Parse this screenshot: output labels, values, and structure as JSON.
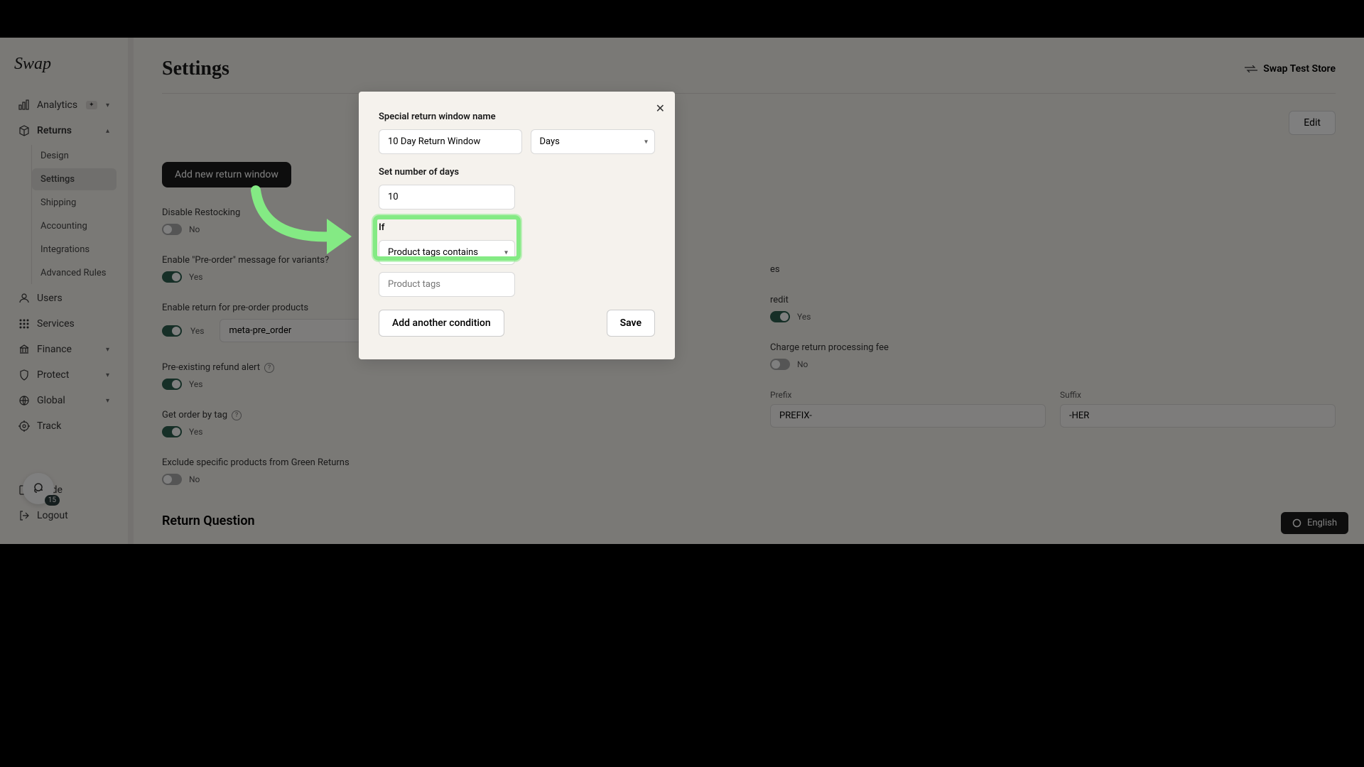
{
  "logo": "Swap",
  "sidebar": {
    "analytics": "Analytics",
    "returns": "Returns",
    "sub": {
      "design": "Design",
      "settings": "Settings",
      "shipping": "Shipping",
      "accounting": "Accounting",
      "integrations": "Integrations",
      "advanced": "Advanced Rules"
    },
    "users": "Users",
    "services": "Services",
    "finance": "Finance",
    "protect": "Protect",
    "global": "Global",
    "track": "Track",
    "guide": "Guide",
    "logout": "Logout"
  },
  "chat_badge": "15",
  "header": {
    "title": "Settings",
    "store": "Swap Test Store",
    "edit": "Edit"
  },
  "buttons": {
    "add_return_window": "Add new return window"
  },
  "settings": {
    "disable_restocking": {
      "label": "Disable Restocking",
      "value": "No"
    },
    "preorder_msg": {
      "label": "Enable \"Pre-order\" message for variants?",
      "value": "Yes"
    },
    "preorder_return": {
      "label": "Enable return for pre-order products",
      "value": "Yes",
      "input": "meta-pre_order"
    },
    "refund_alert": {
      "label": "Pre-existing refund alert",
      "value": "Yes"
    },
    "order_by_tag": {
      "label": "Get order by tag",
      "value": "Yes"
    },
    "exclude_green": {
      "label": "Exclude specific products from Green Returns",
      "value": "No"
    },
    "right1": {
      "label": "es",
      "value": ""
    },
    "store_credit": {
      "label": "redit",
      "value": "Yes"
    },
    "processing_fee": {
      "label": "Charge return processing fee",
      "value": "No"
    },
    "prefix": {
      "label": "Prefix",
      "value": "PREFIX-"
    },
    "suffix": {
      "label": "Suffix",
      "value": "-HER"
    },
    "return_question": "Return Question"
  },
  "modal": {
    "name_label": "Special return window name",
    "name_value": "10 Day Return Window",
    "unit": "Days",
    "days_label": "Set number of days",
    "days_value": "10",
    "if_label": "If",
    "condition_value": "Product tags contains",
    "tags_placeholder": "Product tags",
    "add_condition": "Add another condition",
    "save": "Save"
  },
  "lang": "English"
}
